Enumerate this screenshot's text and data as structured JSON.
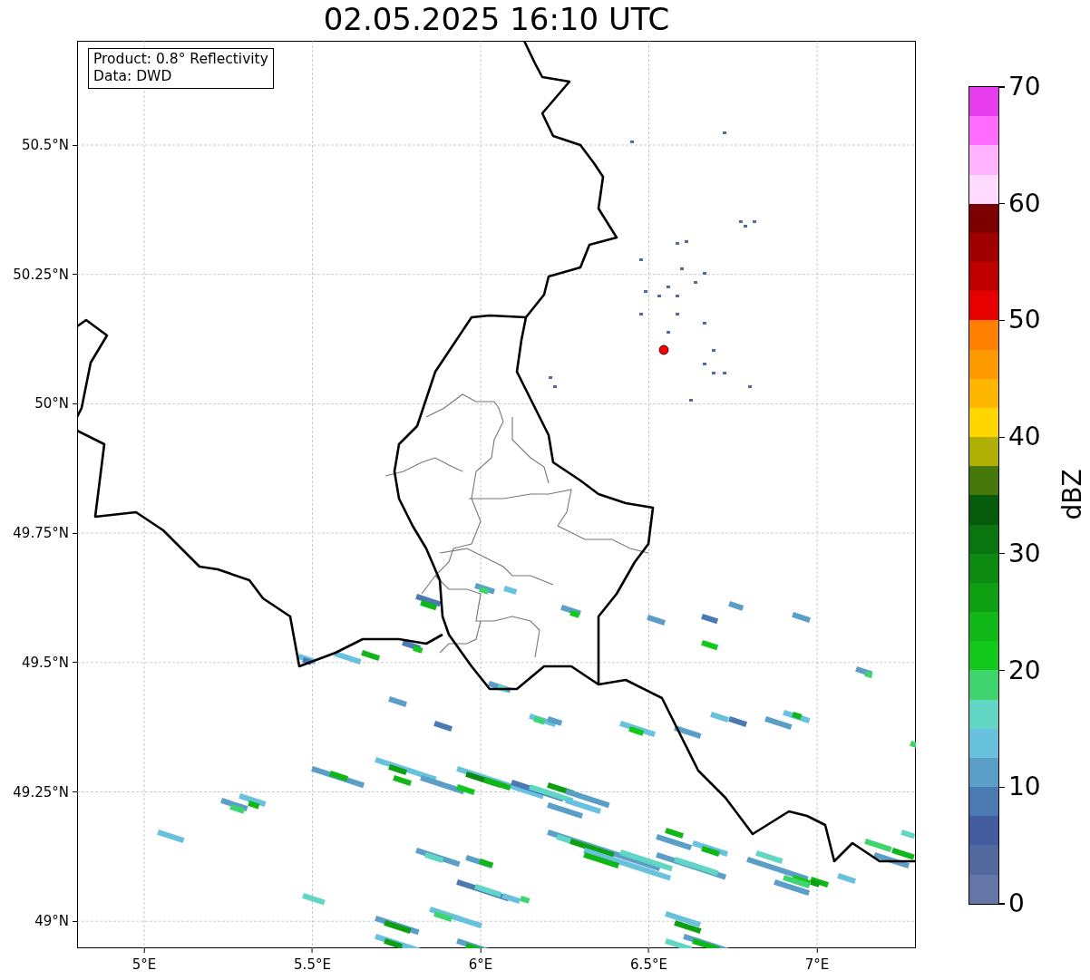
{
  "title": "02.05.2025 16:10 UTC",
  "info_box": {
    "product": "Product: 0.8° Reflectivity",
    "source": "Data: DWD"
  },
  "map": {
    "xticks": [
      "5°E",
      "5.5°E",
      "6°E",
      "6.5°E",
      "7°E"
    ],
    "yticks": [
      "50.5°N",
      "50.25°N",
      "50°N",
      "49.75°N",
      "49.5°N",
      "49.25°N",
      "49°N"
    ]
  },
  "colorbar": {
    "label": "dBZ",
    "ticks": [
      "70",
      "60",
      "50",
      "40",
      "30",
      "20",
      "10",
      "0"
    ],
    "segments": [
      {
        "color": "#e83cef"
      },
      {
        "color": "#ff6cff"
      },
      {
        "color": "#ffb3ff"
      },
      {
        "color": "#ffdcff"
      },
      {
        "color": "#7d0000"
      },
      {
        "color": "#a00000"
      },
      {
        "color": "#c00000"
      },
      {
        "color": "#e60000"
      },
      {
        "color": "#ff7f00"
      },
      {
        "color": "#ff9900"
      },
      {
        "color": "#ffb600"
      },
      {
        "color": "#ffd700"
      },
      {
        "color": "#afaf05"
      },
      {
        "color": "#46780a"
      },
      {
        "color": "#065c0c"
      },
      {
        "color": "#0a7410"
      },
      {
        "color": "#0c8a12"
      },
      {
        "color": "#0ea012"
      },
      {
        "color": "#0fb816"
      },
      {
        "color": "#12c81a"
      },
      {
        "color": "#3fd46e"
      },
      {
        "color": "#62d6c4"
      },
      {
        "color": "#68c2de"
      },
      {
        "color": "#5b9ec8"
      },
      {
        "color": "#4b7ab2"
      },
      {
        "color": "#445da0"
      },
      {
        "color": "#53689e"
      },
      {
        "color": "#6675a8"
      }
    ]
  }
}
